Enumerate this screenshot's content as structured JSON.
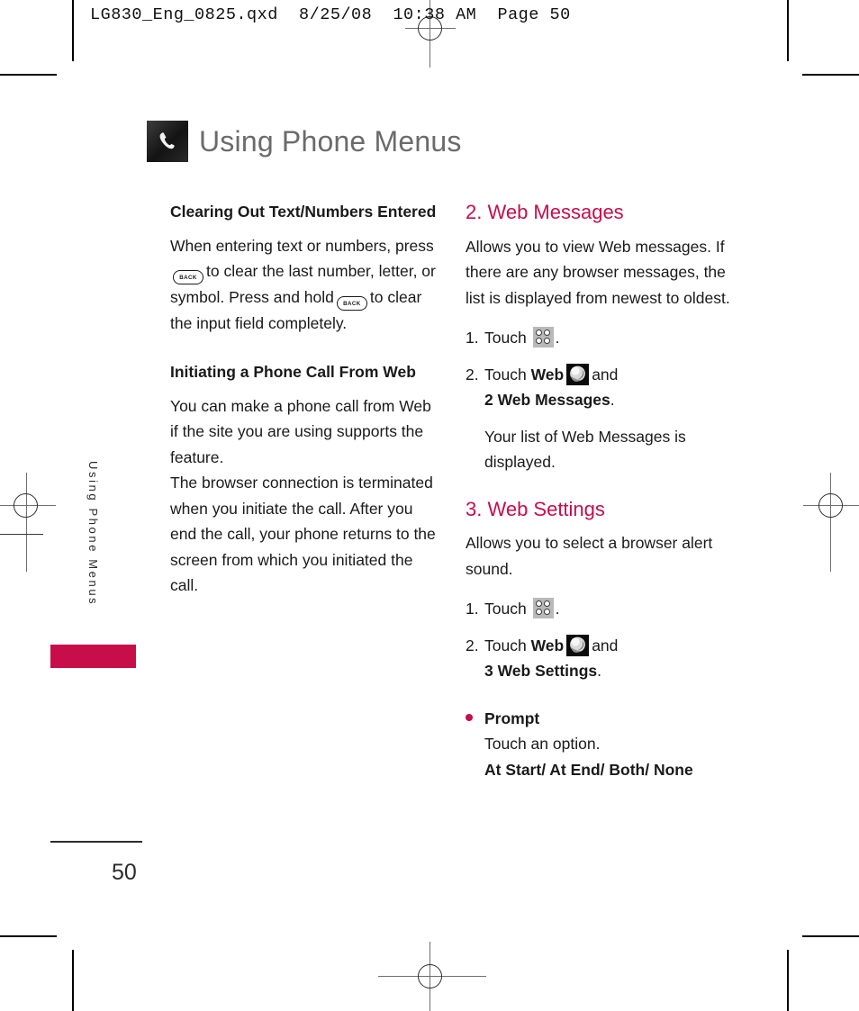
{
  "prepress": {
    "header": "LG830_Eng_0825.qxd  8/25/08  10:38 AM  Page 50"
  },
  "page": {
    "title": "Using Phone Menus",
    "title_icon": "phone-handset-icon",
    "side_tab_label": "Using Phone Menus",
    "page_number": "50",
    "accent_color": "#c80d4b",
    "title_color": "#6b6b6b"
  },
  "left_column": {
    "heading1": "Clearing Out Text/Numbers Entered",
    "para1_a": "When entering text or numbers, press",
    "key1": "BACK",
    "para1_b": "to clear the last number, letter, or symbol. Press and hold",
    "key2": "BACK",
    "para1_c": "to clear the input field completely.",
    "heading2": "Initiating a Phone Call From Web",
    "para2": "You can make a phone call from Web if the site you are using supports the feature.",
    "para3": "The browser connection is terminated when you initiate the call. After you end the call, your phone returns to the screen from which you initiated the call."
  },
  "right_column": {
    "section2": {
      "heading": "2. Web Messages",
      "intro": "Allows you to view Web messages. If there are any browser messages, the list is displayed from newest to oldest.",
      "step1_num": "1.",
      "step1_text": "Touch",
      "step1_icon": "menu-grid-icon",
      "step1_end": ".",
      "step2_num": "2.",
      "step2_text_a": "Touch",
      "step2_bold": "Web",
      "step2_icon": "web-globe-icon",
      "step2_text_b": "and",
      "step2_target": "2 Web Messages",
      "step2_end": ".",
      "note": "Your list of Web Messages is displayed."
    },
    "section3": {
      "heading": "3. Web Settings",
      "intro": "Allows you to select a browser alert sound.",
      "step1_num": "1.",
      "step1_text": "Touch",
      "step1_icon": "menu-grid-icon",
      "step1_end": ".",
      "step2_num": "2.",
      "step2_text_a": "Touch",
      "step2_bold": "Web",
      "step2_icon": "web-globe-icon",
      "step2_text_b": "and",
      "step2_target": "3 Web Settings",
      "step2_end": ".",
      "bullet": {
        "title": "Prompt",
        "desc": "Touch an option.",
        "options": "At Start/ At End/ Both/ None"
      }
    }
  }
}
